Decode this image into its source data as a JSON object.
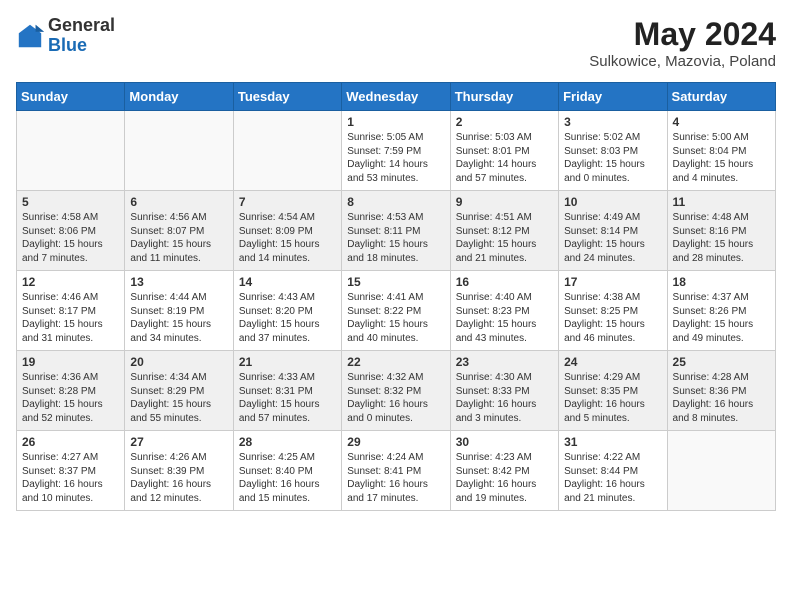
{
  "header": {
    "logo_general": "General",
    "logo_blue": "Blue",
    "month_year": "May 2024",
    "location": "Sulkowice, Mazovia, Poland"
  },
  "weekdays": [
    "Sunday",
    "Monday",
    "Tuesday",
    "Wednesday",
    "Thursday",
    "Friday",
    "Saturday"
  ],
  "weeks": [
    [
      {
        "day": "",
        "info": ""
      },
      {
        "day": "",
        "info": ""
      },
      {
        "day": "",
        "info": ""
      },
      {
        "day": "1",
        "info": "Sunrise: 5:05 AM\nSunset: 7:59 PM\nDaylight: 14 hours\nand 53 minutes."
      },
      {
        "day": "2",
        "info": "Sunrise: 5:03 AM\nSunset: 8:01 PM\nDaylight: 14 hours\nand 57 minutes."
      },
      {
        "day": "3",
        "info": "Sunrise: 5:02 AM\nSunset: 8:03 PM\nDaylight: 15 hours\nand 0 minutes."
      },
      {
        "day": "4",
        "info": "Sunrise: 5:00 AM\nSunset: 8:04 PM\nDaylight: 15 hours\nand 4 minutes."
      }
    ],
    [
      {
        "day": "5",
        "info": "Sunrise: 4:58 AM\nSunset: 8:06 PM\nDaylight: 15 hours\nand 7 minutes."
      },
      {
        "day": "6",
        "info": "Sunrise: 4:56 AM\nSunset: 8:07 PM\nDaylight: 15 hours\nand 11 minutes."
      },
      {
        "day": "7",
        "info": "Sunrise: 4:54 AM\nSunset: 8:09 PM\nDaylight: 15 hours\nand 14 minutes."
      },
      {
        "day": "8",
        "info": "Sunrise: 4:53 AM\nSunset: 8:11 PM\nDaylight: 15 hours\nand 18 minutes."
      },
      {
        "day": "9",
        "info": "Sunrise: 4:51 AM\nSunset: 8:12 PM\nDaylight: 15 hours\nand 21 minutes."
      },
      {
        "day": "10",
        "info": "Sunrise: 4:49 AM\nSunset: 8:14 PM\nDaylight: 15 hours\nand 24 minutes."
      },
      {
        "day": "11",
        "info": "Sunrise: 4:48 AM\nSunset: 8:16 PM\nDaylight: 15 hours\nand 28 minutes."
      }
    ],
    [
      {
        "day": "12",
        "info": "Sunrise: 4:46 AM\nSunset: 8:17 PM\nDaylight: 15 hours\nand 31 minutes."
      },
      {
        "day": "13",
        "info": "Sunrise: 4:44 AM\nSunset: 8:19 PM\nDaylight: 15 hours\nand 34 minutes."
      },
      {
        "day": "14",
        "info": "Sunrise: 4:43 AM\nSunset: 8:20 PM\nDaylight: 15 hours\nand 37 minutes."
      },
      {
        "day": "15",
        "info": "Sunrise: 4:41 AM\nSunset: 8:22 PM\nDaylight: 15 hours\nand 40 minutes."
      },
      {
        "day": "16",
        "info": "Sunrise: 4:40 AM\nSunset: 8:23 PM\nDaylight: 15 hours\nand 43 minutes."
      },
      {
        "day": "17",
        "info": "Sunrise: 4:38 AM\nSunset: 8:25 PM\nDaylight: 15 hours\nand 46 minutes."
      },
      {
        "day": "18",
        "info": "Sunrise: 4:37 AM\nSunset: 8:26 PM\nDaylight: 15 hours\nand 49 minutes."
      }
    ],
    [
      {
        "day": "19",
        "info": "Sunrise: 4:36 AM\nSunset: 8:28 PM\nDaylight: 15 hours\nand 52 minutes."
      },
      {
        "day": "20",
        "info": "Sunrise: 4:34 AM\nSunset: 8:29 PM\nDaylight: 15 hours\nand 55 minutes."
      },
      {
        "day": "21",
        "info": "Sunrise: 4:33 AM\nSunset: 8:31 PM\nDaylight: 15 hours\nand 57 minutes."
      },
      {
        "day": "22",
        "info": "Sunrise: 4:32 AM\nSunset: 8:32 PM\nDaylight: 16 hours\nand 0 minutes."
      },
      {
        "day": "23",
        "info": "Sunrise: 4:30 AM\nSunset: 8:33 PM\nDaylight: 16 hours\nand 3 minutes."
      },
      {
        "day": "24",
        "info": "Sunrise: 4:29 AM\nSunset: 8:35 PM\nDaylight: 16 hours\nand 5 minutes."
      },
      {
        "day": "25",
        "info": "Sunrise: 4:28 AM\nSunset: 8:36 PM\nDaylight: 16 hours\nand 8 minutes."
      }
    ],
    [
      {
        "day": "26",
        "info": "Sunrise: 4:27 AM\nSunset: 8:37 PM\nDaylight: 16 hours\nand 10 minutes."
      },
      {
        "day": "27",
        "info": "Sunrise: 4:26 AM\nSunset: 8:39 PM\nDaylight: 16 hours\nand 12 minutes."
      },
      {
        "day": "28",
        "info": "Sunrise: 4:25 AM\nSunset: 8:40 PM\nDaylight: 16 hours\nand 15 minutes."
      },
      {
        "day": "29",
        "info": "Sunrise: 4:24 AM\nSunset: 8:41 PM\nDaylight: 16 hours\nand 17 minutes."
      },
      {
        "day": "30",
        "info": "Sunrise: 4:23 AM\nSunset: 8:42 PM\nDaylight: 16 hours\nand 19 minutes."
      },
      {
        "day": "31",
        "info": "Sunrise: 4:22 AM\nSunset: 8:44 PM\nDaylight: 16 hours\nand 21 minutes."
      },
      {
        "day": "",
        "info": ""
      }
    ]
  ]
}
